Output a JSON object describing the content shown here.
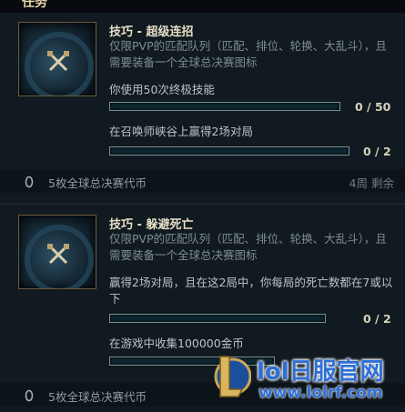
{
  "header": {
    "title": "任务"
  },
  "missions": [
    {
      "title": "技巧 - 超级连招",
      "description": "仅限PVP的匹配队列（匹配、排位、轮换、大乱斗），且需要装备一个全球总决赛图标",
      "objectives": [
        {
          "label": "你使用50次终极技能",
          "count": "0 / 50",
          "progress": 0
        },
        {
          "label": "在召唤师峡谷上赢得2场对局",
          "count": "0 / 2",
          "progress": 0
        }
      ],
      "reward": "5枚全球总决赛代币",
      "time_left": "4周 剩余"
    },
    {
      "title": "技巧 - 躲避死亡",
      "description": "仅限PVP的匹配队列（匹配、排位、轮换、大乱斗），且需要装备一个全球总决赛图标",
      "objectives": [
        {
          "label": "赢得2场对局，且在这2局中，你每局的死亡数都在7或以下",
          "count": "0 / 2",
          "progress": 0
        },
        {
          "label": "在游戏中收集100000金币",
          "count": "",
          "progress": 0
        }
      ],
      "reward": "5枚全球总决赛代币",
      "time_left": ""
    }
  ],
  "watermark": {
    "name": "lol日服官网",
    "url": "www.lolrf.com"
  },
  "colors": {
    "accent": "#2bb2c7",
    "gold": "#cdbe91",
    "watermark": "#2e6fd6"
  },
  "icons": {
    "mission_icon": "crossed-swords-icon",
    "token_icon": "token-icon",
    "logo": "lol-logo-icon"
  }
}
